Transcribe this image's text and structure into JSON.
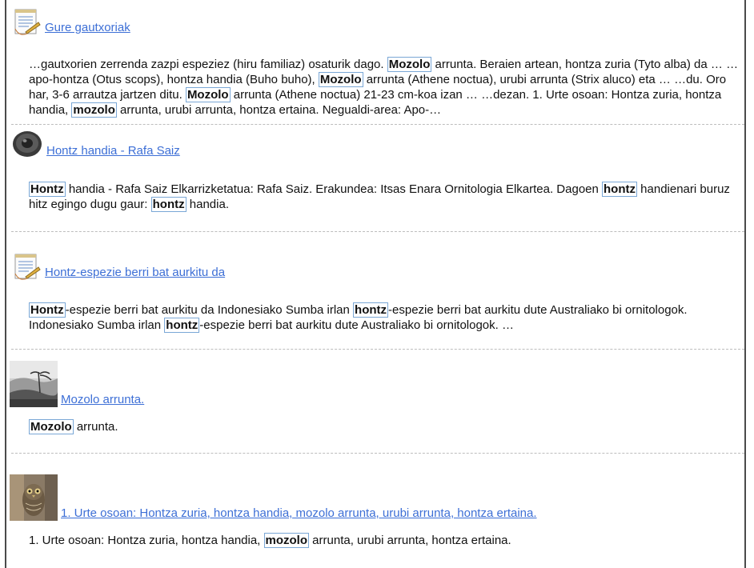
{
  "results": [
    {
      "icon": "notepad-icon",
      "title": "Gure gautxoriak",
      "snippet": [
        {
          "t": "…gautxorien zerrenda zazpi espeziez (hiru familiaz) osaturik dago. "
        },
        {
          "t": "Mozolo",
          "hl": true
        },
        {
          "t": " arrunta. Beraien artean, hontza zuria (Tyto alba) da … …apo-hontza (Otus scops), hontza handia (Buho buho), "
        },
        {
          "t": "Mozolo",
          "hl": true
        },
        {
          "t": " arrunta (Athene noctua), urubi arrunta (Strix aluco) eta … …du. Oro har, 3-6 arrautza jartzen ditu. "
        },
        {
          "t": "Mozolo",
          "hl": true
        },
        {
          "t": " arrunta (Athene noctua) 21-23 cm-koa izan … …dezan. 1. Urte osoan: Hontza zuria, hontza handia, "
        },
        {
          "t": "mozolo",
          "hl": true
        },
        {
          "t": " arrunta, urubi arrunta, hontza ertaina. Negualdi-area: Apo-…"
        }
      ]
    },
    {
      "icon": "speaker-icon",
      "title": "Hontz handia - Rafa Saiz",
      "snippet": [
        {
          "t": "Hontz",
          "hl": true
        },
        {
          "t": " handia - Rafa Saiz Elkarrizketatua: Rafa Saiz. Erakundea: Itsas Enara Ornitologia Elkartea. Dagoen "
        },
        {
          "t": "hontz",
          "hl": true
        },
        {
          "t": " handienari buruz hitz egingo dugu gaur: "
        },
        {
          "t": "hontz",
          "hl": true
        },
        {
          "t": " handia."
        }
      ]
    },
    {
      "icon": "notepad-icon",
      "title": "Hontz-espezie berri bat aurkitu da",
      "snippet": [
        {
          "t": "Hontz",
          "hl": true
        },
        {
          "t": "-espezie berri bat aurkitu da Indonesiako Sumba irlan "
        },
        {
          "t": "hontz",
          "hl": true
        },
        {
          "t": "-espezie berri bat aurkitu dute Australiako bi ornitologok. Indonesiako Sumba irlan "
        },
        {
          "t": "hontz",
          "hl": true
        },
        {
          "t": "-espezie berri bat aurkitu dute Australiako bi ornitologok. …"
        }
      ]
    },
    {
      "icon": "landscape-photo-icon",
      "title": "Mozolo arrunta.",
      "snippet": [
        {
          "t": "Mozolo",
          "hl": true
        },
        {
          "t": " arrunta."
        }
      ]
    },
    {
      "icon": "owl-photo-icon",
      "title": "1. Urte osoan: Hontza zuria, hontza handia, mozolo arrunta, urubi arrunta, hontza ertaina.",
      "snippet": [
        {
          "t": "1. Urte osoan: Hontza zuria, hontza handia, "
        },
        {
          "t": "mozolo",
          "hl": true
        },
        {
          "t": " arrunta, urubi arrunta, hontza ertaina."
        }
      ]
    }
  ]
}
